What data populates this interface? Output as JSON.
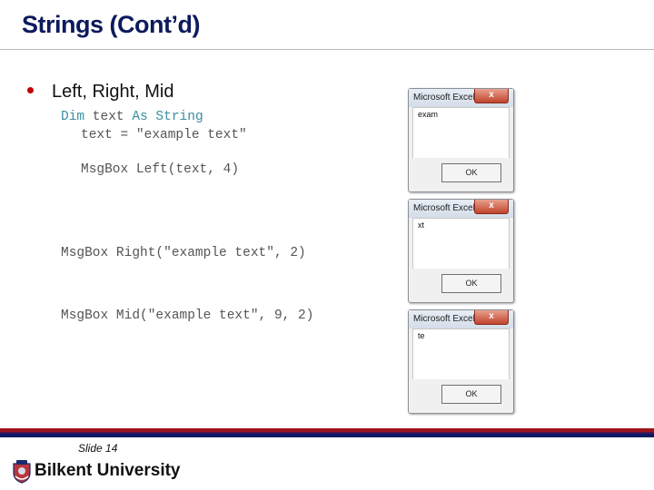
{
  "slide": {
    "title": "Strings (Cont’d)",
    "bullet": "Left, Right, Mid",
    "code": {
      "line1_kw1": "Dim",
      "line1_var": " text ",
      "line1_kw2": "As String",
      "line2": "text = \"example text\"",
      "line3": "MsgBox Left(text, 4)",
      "line4": "MsgBox Right(\"example text\", 2)",
      "line5": "MsgBox Mid(\"example text\", 9, 2)"
    },
    "dialogs": [
      {
        "title": "Microsoft Excel",
        "close": "x",
        "message": "exam",
        "ok": "OK"
      },
      {
        "title": "Microsoft Excel",
        "close": "x",
        "message": "xt",
        "ok": "OK"
      },
      {
        "title": "Microsoft Excel",
        "close": "x",
        "message": "te",
        "ok": "OK"
      }
    ],
    "footer": {
      "slide_number": "Slide 14",
      "university": "Bilkent University"
    },
    "colors": {
      "title": "#0d1a5c",
      "bullet": "#c00000",
      "keyword": "#3a8fa0",
      "stripe_red": "#a0141e",
      "stripe_blue": "#0b1a66"
    }
  }
}
